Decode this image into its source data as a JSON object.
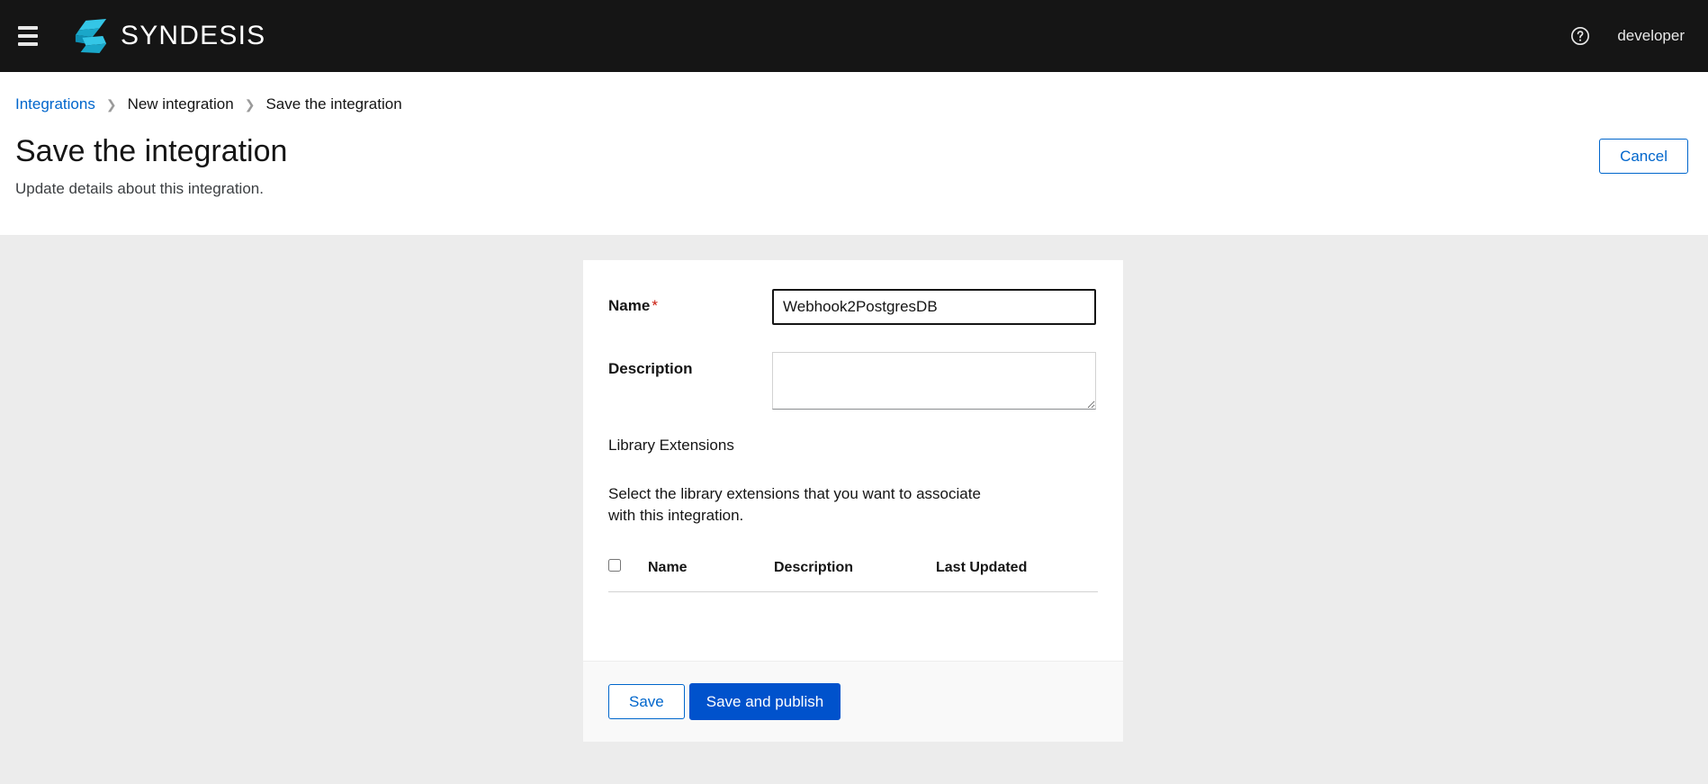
{
  "masthead": {
    "menu_icon": "hamburger-icon",
    "logo_icon": "syndesis-logo-icon",
    "brand_name": "SYNDESIS",
    "help_icon": "help-circle-icon",
    "user_name": "developer",
    "background_color": "#151515"
  },
  "breadcrumb": {
    "items": [
      {
        "label": "Integrations",
        "is_link": true
      },
      {
        "label": "New integration",
        "is_link": false
      },
      {
        "label": "Save the integration",
        "is_link": false
      }
    ],
    "separator": "❯"
  },
  "header": {
    "title": "Save the integration",
    "subtitle": "Update details about this integration.",
    "cancel_label": "Cancel"
  },
  "form": {
    "name": {
      "label": "Name",
      "required_marker": "*",
      "value": "Webhook2PostgresDB",
      "placeholder": ""
    },
    "description": {
      "label": "Description",
      "value": "",
      "placeholder": ""
    },
    "library_extensions": {
      "section_label": "Library Extensions",
      "help_text": "Select the library extensions that you want to associate with this integration.",
      "table": {
        "select_all_checkbox": "select-all-extensions-checkbox",
        "columns": [
          "Name",
          "Description",
          "Last Updated"
        ],
        "rows": []
      }
    },
    "footer": {
      "save_label": "Save",
      "save_publish_label": "Save and publish"
    }
  },
  "colors": {
    "accent_blue": "#0066cc",
    "primary_button": "#0052cc",
    "required_red": "#c9190b",
    "page_background": "#ececec",
    "logo_cyan": "#29b6d8"
  }
}
